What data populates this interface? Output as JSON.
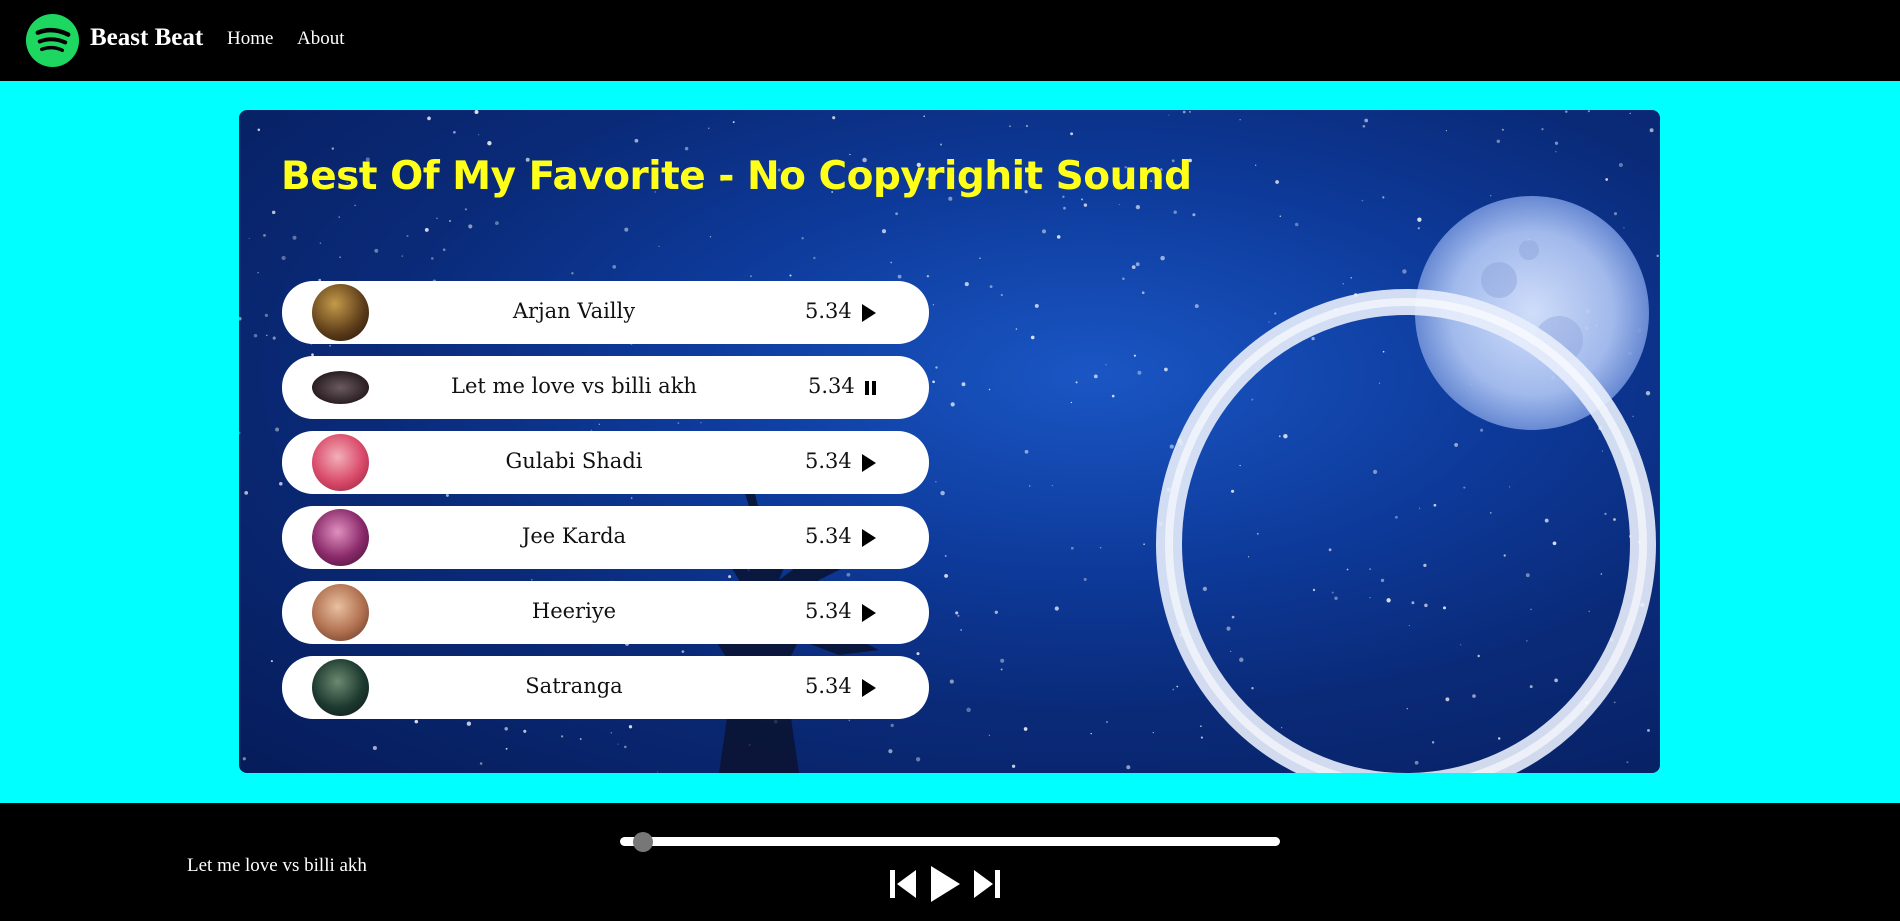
{
  "nav": {
    "brand": "Beast Beat",
    "links": [
      "Home",
      "About"
    ]
  },
  "main": {
    "title": "Best Of My Favorite - No Copyrighit Sound",
    "songs": [
      {
        "name": "Arjan Vailly",
        "duration": "5.34",
        "state": "play",
        "cover_color": "#6b4a1e"
      },
      {
        "name": "Let me love vs billi akh",
        "duration": "5.34",
        "state": "pause",
        "cover_color": "#3a2a2e"
      },
      {
        "name": "Gulabi Shadi",
        "duration": "5.34",
        "state": "play",
        "cover_color": "#d94a6a"
      },
      {
        "name": "Jee Karda",
        "duration": "5.34",
        "state": "play",
        "cover_color": "#8a2a6a"
      },
      {
        "name": "Heeriye",
        "duration": "5.34",
        "state": "play",
        "cover_color": "#b07050"
      },
      {
        "name": "Satranga",
        "duration": "5.34",
        "state": "play",
        "cover_color": "#1e3a30"
      }
    ]
  },
  "player": {
    "now_playing": "Let me love vs billi akh",
    "progress": 0.02
  },
  "colors": {
    "nav_bg": "#000000",
    "page_bg": "#00ffff",
    "title": "#ffff1a",
    "logo": "#1ed760"
  },
  "icons": [
    "spotify-logo-icon",
    "play-icon",
    "pause-icon",
    "previous-icon",
    "next-icon"
  ]
}
